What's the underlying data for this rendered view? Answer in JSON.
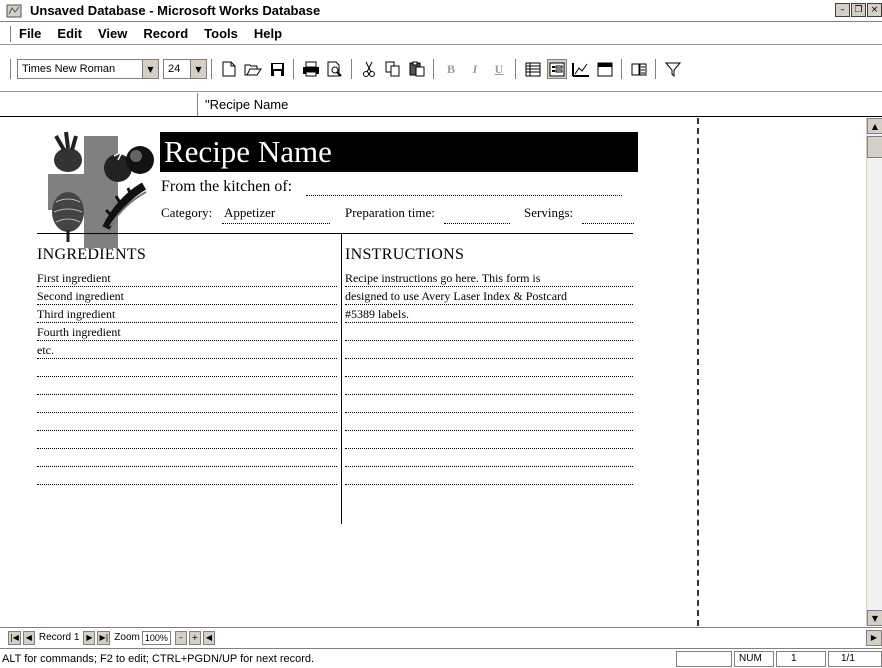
{
  "window": {
    "title": "Unsaved Database - Microsoft Works Database"
  },
  "menu": [
    "File",
    "Edit",
    "View",
    "Record",
    "Tools",
    "Help"
  ],
  "toolbar": {
    "font_name": "Times New Roman",
    "font_size": "24",
    "bold_label": "B",
    "italic_label": "I",
    "underline_label": "U"
  },
  "entry_bar": {
    "text": "\"Recipe Name"
  },
  "form": {
    "title": "Recipe Name",
    "kitchen_label": "From the kitchen of:",
    "category_label": "Category:",
    "category_value": "Appetizer",
    "prep_time_label": "Preparation time:",
    "servings_label": "Servings:",
    "ingredients_heading": "INGREDIENTS",
    "instructions_heading": "INSTRUCTIONS",
    "ingredients": [
      "First ingredient",
      "Second ingredient",
      "Third ingredient",
      "Fourth ingredient",
      "etc.",
      "",
      "",
      "",
      "",
      "",
      "",
      ""
    ],
    "instructions": [
      "Recipe instructions go here. This form is",
      "designed to use Avery Laser Index & Postcard",
      "#5389 labels.",
      "",
      "",
      "",
      "",
      "",
      "",
      "",
      "",
      ""
    ]
  },
  "navigation": {
    "record_label": "Record 1",
    "zoom_label": "Zoom",
    "zoom_value": "100%"
  },
  "status": {
    "message": "ALT for commands; F2 to edit; CTRL+PGDN/UP for next record.",
    "num_indicator": "NUM",
    "record_count": "1",
    "record_position": "1/1"
  },
  "icons": [
    "app-icon",
    "new-icon",
    "open-icon",
    "save-icon",
    "print-icon",
    "print-preview-icon",
    "cut-icon",
    "copy-icon",
    "paste-icon",
    "list-view-icon",
    "form-view-icon",
    "form-design-icon",
    "report-view-icon",
    "insert-field-icon",
    "filter-icon"
  ]
}
